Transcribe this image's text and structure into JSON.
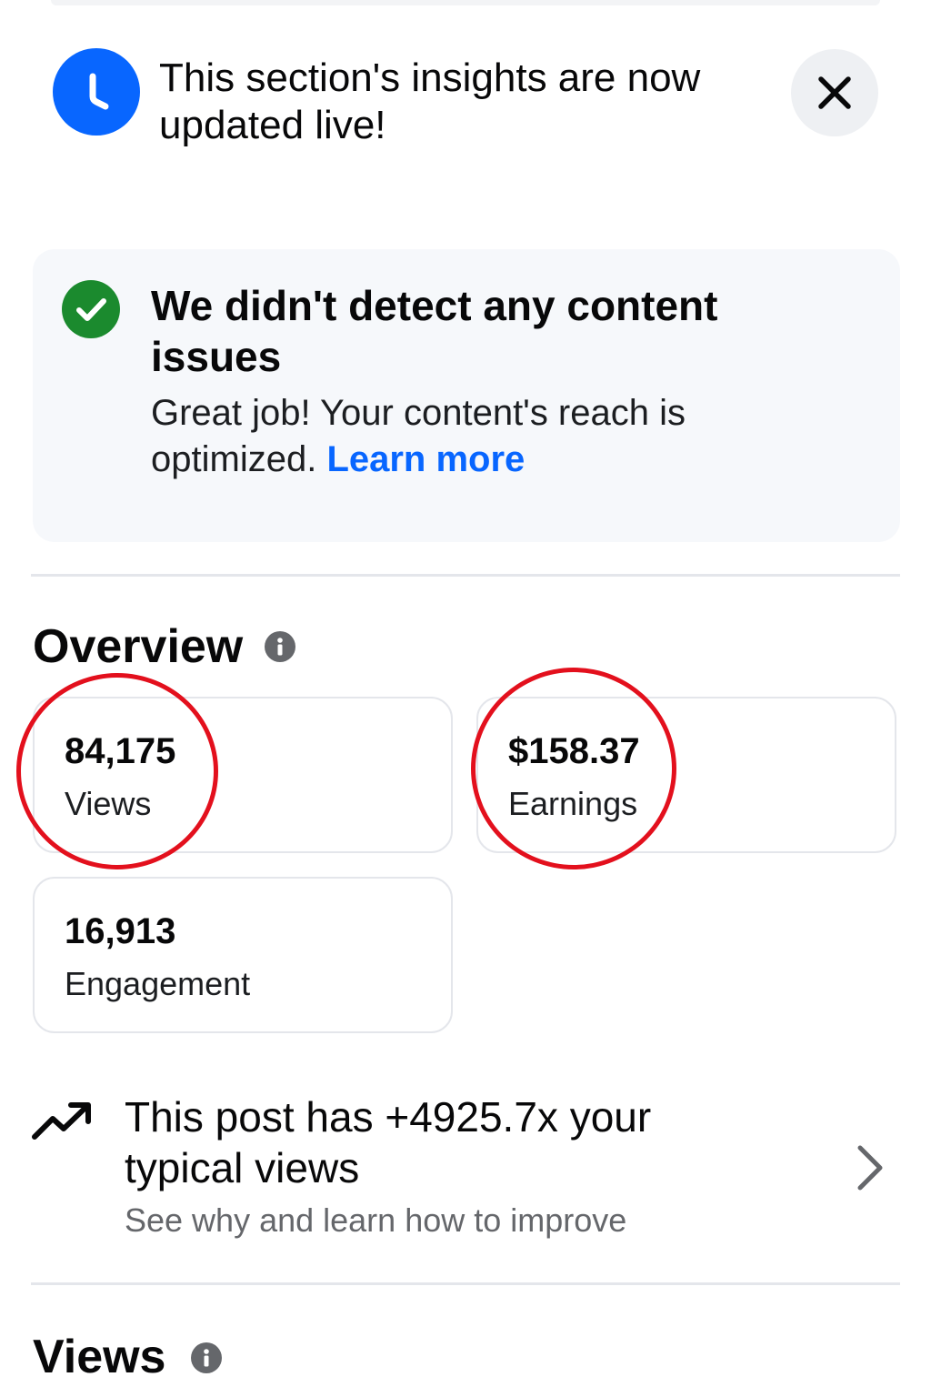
{
  "banner": {
    "text": "This section's insights are now updated live!",
    "icon": "clock-icon",
    "close_icon": "close-icon",
    "accent_color": "#0866ff"
  },
  "content_check": {
    "title": "We didn't detect any content issues",
    "body": "Great job! Your content's reach is optimized.",
    "link_label": "Learn more",
    "icon": "check-circle-icon",
    "status_color": "#1b8a2e"
  },
  "overview": {
    "title": "Overview",
    "info_icon": "info-icon",
    "metrics": [
      {
        "value": "84,175",
        "label": "Views",
        "highlighted": true
      },
      {
        "value": "$158.37",
        "label": "Earnings",
        "highlighted": true
      },
      {
        "value": "16,913",
        "label": "Engagement",
        "highlighted": false
      }
    ],
    "highlight_color": "#e3101d"
  },
  "insight": {
    "title": "This post has +4925.7x your typical views",
    "subtitle": "See why and learn how to improve",
    "icon": "trending-up-icon",
    "chevron": "chevron-right-icon"
  },
  "views_section": {
    "title": "Views",
    "info_icon": "info-icon"
  }
}
